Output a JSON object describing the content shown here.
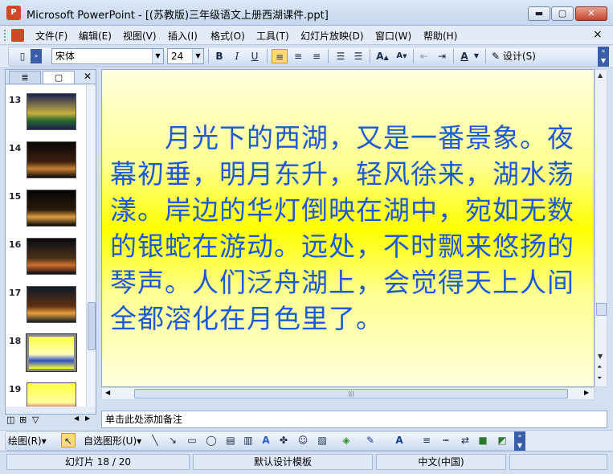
{
  "window": {
    "app_icon": "powerpoint-icon",
    "title": "Microsoft PowerPoint - [(苏教版)三年级语文上册西湖课件.ppt]",
    "min_glyph": "▬",
    "max_glyph": "▢",
    "close_glyph": "✕"
  },
  "menu": {
    "items": [
      "文件(F)",
      "编辑(E)",
      "视图(V)",
      "插入(I)",
      "格式(O)",
      "工具(T)",
      "幻灯片放映(D)",
      "窗口(W)",
      "帮助(H)"
    ],
    "close_glyph": "×"
  },
  "toolbar": {
    "font_name": "宋体",
    "font_size": "24",
    "bold": "B",
    "italic": "I",
    "underline": "U",
    "design_label": "设计(S)"
  },
  "slides_panel": {
    "tabs": [
      "outline-tab",
      "slides-tab"
    ],
    "slides": [
      {
        "num": "13",
        "colors": [
          "#1a2050",
          "#c8b040",
          "#2a6a2a"
        ]
      },
      {
        "num": "14",
        "colors": [
          "#0a0608",
          "#3a2010",
          "#c88030"
        ]
      },
      {
        "num": "15",
        "colors": [
          "#050505",
          "#2a1a08",
          "#e0a040"
        ]
      },
      {
        "num": "16",
        "colors": [
          "#0a0a12",
          "#4a3018",
          "#d07030"
        ]
      },
      {
        "num": "17",
        "colors": [
          "#101828",
          "#603010",
          "#e8a040"
        ]
      },
      {
        "num": "18",
        "colors": [
          "#ffff40",
          "#ffffc0",
          "#3050c0"
        ]
      },
      {
        "num": "19",
        "colors": [
          "#ffff40",
          "#ffffa0",
          "#e03030"
        ]
      }
    ],
    "selected": "18"
  },
  "slide": {
    "text": "　　月光下的西湖，又是一番景象。夜幕初垂，明月东升，轻风徐来，湖水荡漾。岸边的华灯倒映在湖中，宛如无数的银蛇在游动。远处，不时飘来悠扬的琴声。人们泛舟湖上，会觉得天上人间全都溶化在月色里了。"
  },
  "notes": {
    "placeholder": "单击此处添加备注"
  },
  "drawing_toolbar": {
    "draw_label": "绘图(R)",
    "autoshape_label": "自选图形(U)"
  },
  "status": {
    "slide_info": "幻灯片 18 / 20",
    "template": "默认设计模板",
    "language": "中文(中国)"
  }
}
